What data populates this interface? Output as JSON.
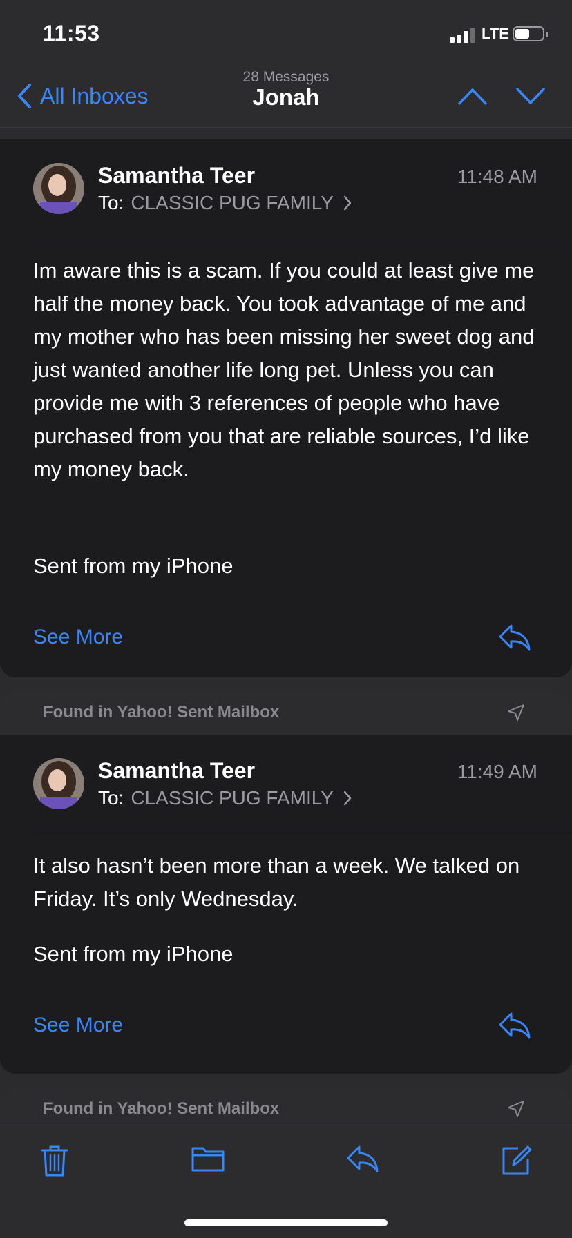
{
  "status_bar": {
    "time": "11:53",
    "network": "LTE"
  },
  "nav": {
    "back_label": "All Inboxes",
    "message_count": "28 Messages",
    "title": "Jonah"
  },
  "messages": [
    {
      "sender": "Samantha Teer",
      "to_label": "To:",
      "recipient": "CLASSIC PUG FAMILY",
      "time": "11:48 AM",
      "body": "Im aware this is a scam. If you could at least give me half the money back. You took advantage of me and my mother who has been missing her sweet dog and just wanted another life long pet. Unless you can provide me with 3 references of people who have purchased from you that are reliable sources, I’d like my money back.",
      "signature": "Sent from my iPhone",
      "see_more": "See More"
    },
    {
      "found_in": "Found in Yahoo! Sent Mailbox",
      "sender": "Samantha Teer",
      "to_label": "To:",
      "recipient": "CLASSIC PUG FAMILY",
      "time": "11:49 AM",
      "body": "It also hasn’t been more than a week. We talked on Friday. It’s only Wednesday.",
      "signature": "Sent from my iPhone",
      "see_more": "See More"
    }
  ],
  "next_found_in": "Found in Yahoo! Sent Mailbox",
  "colors": {
    "accent": "#3a86f5",
    "background": "#1c1c1e",
    "secondary_text": "#9a9a9f"
  },
  "icons": [
    "back-chevron-icon",
    "chevron-up-icon",
    "chevron-down-icon",
    "reply-icon",
    "sent-arrow-icon",
    "trash-icon",
    "folder-icon",
    "compose-icon"
  ]
}
